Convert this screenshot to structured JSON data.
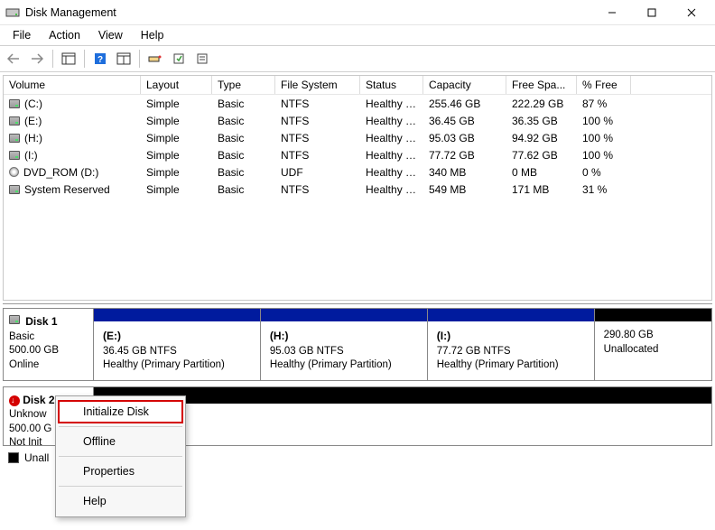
{
  "window": {
    "title": "Disk Management"
  },
  "menu": {
    "items": [
      "File",
      "Action",
      "View",
      "Help"
    ]
  },
  "columns": {
    "volume": "Volume",
    "layout": "Layout",
    "type": "Type",
    "fs": "File System",
    "status": "Status",
    "capacity": "Capacity",
    "free": "Free Spa...",
    "pct": "% Free"
  },
  "volumes": [
    {
      "icon": "drive",
      "name": "(C:)",
      "layout": "Simple",
      "type": "Basic",
      "fs": "NTFS",
      "status": "Healthy (B...",
      "capacity": "255.46 GB",
      "free": "222.29 GB",
      "pct": "87 %"
    },
    {
      "icon": "drive",
      "name": "(E:)",
      "layout": "Simple",
      "type": "Basic",
      "fs": "NTFS",
      "status": "Healthy (P...",
      "capacity": "36.45 GB",
      "free": "36.35 GB",
      "pct": "100 %"
    },
    {
      "icon": "drive",
      "name": "(H:)",
      "layout": "Simple",
      "type": "Basic",
      "fs": "NTFS",
      "status": "Healthy (P...",
      "capacity": "95.03 GB",
      "free": "94.92 GB",
      "pct": "100 %"
    },
    {
      "icon": "drive",
      "name": "(I:)",
      "layout": "Simple",
      "type": "Basic",
      "fs": "NTFS",
      "status": "Healthy (P...",
      "capacity": "77.72 GB",
      "free": "77.62 GB",
      "pct": "100 %"
    },
    {
      "icon": "cd",
      "name": "DVD_ROM (D:)",
      "layout": "Simple",
      "type": "Basic",
      "fs": "UDF",
      "status": "Healthy (P...",
      "capacity": "340 MB",
      "free": "0 MB",
      "pct": "0 %"
    },
    {
      "icon": "drive",
      "name": "System Reserved",
      "layout": "Simple",
      "type": "Basic",
      "fs": "NTFS",
      "status": "Healthy (S...",
      "capacity": "549 MB",
      "free": "171 MB",
      "pct": "31 %"
    }
  ],
  "disk1": {
    "title": "Disk 1",
    "type": "Basic",
    "size": "500.00 GB",
    "state": "Online",
    "parts": [
      {
        "letter": "(E:)",
        "line": "36.45 GB NTFS",
        "status": "Healthy (Primary Partition)",
        "kind": "blue"
      },
      {
        "letter": "(H:)",
        "line": "95.03 GB NTFS",
        "status": "Healthy (Primary Partition)",
        "kind": "blue"
      },
      {
        "letter": "(I:)",
        "line": "77.72 GB NTFS",
        "status": "Healthy (Primary Partition)",
        "kind": "blue"
      },
      {
        "letter": "",
        "line": "290.80 GB",
        "status": "Unallocated",
        "kind": "black"
      }
    ]
  },
  "disk2": {
    "title": "Disk 2",
    "type": "Unknow",
    "size": "500.00 G",
    "state": "Not Init"
  },
  "context_menu": {
    "items": [
      "Initialize Disk",
      "Offline",
      "Properties",
      "Help"
    ],
    "highlighted": 0
  },
  "legend": {
    "unallocated": "Unall"
  }
}
